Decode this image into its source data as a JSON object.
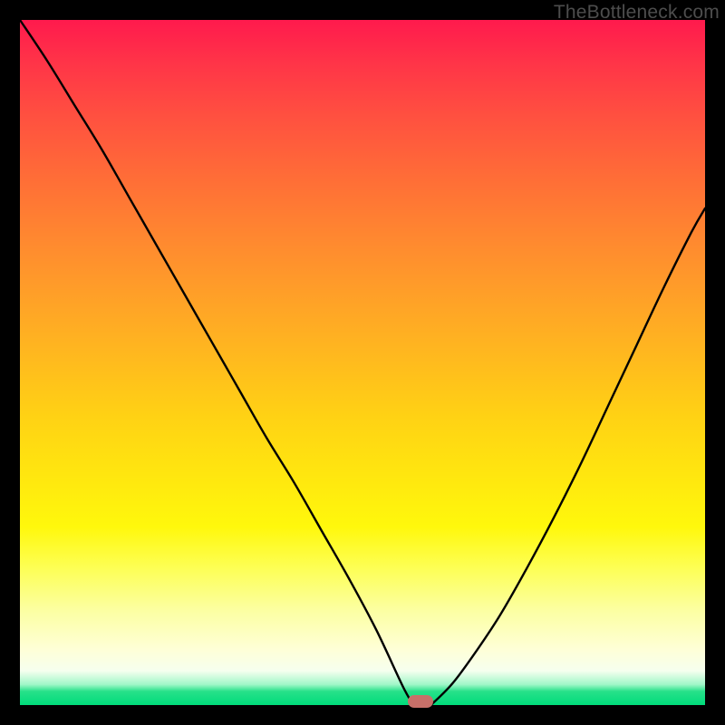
{
  "watermark": {
    "text": "TheBottleneck.com"
  },
  "chart_data": {
    "type": "line",
    "title": "",
    "xlabel": "",
    "ylabel": "",
    "xlim": [
      0,
      100
    ],
    "ylim": [
      0,
      100
    ],
    "series": [
      {
        "name": "left-curve",
        "x": [
          0.0,
          4.0,
          8.0,
          12.0,
          16.0,
          20.0,
          24.0,
          28.0,
          32.0,
          36.0,
          40.0,
          44.0,
          48.0,
          52.0,
          56.0,
          57.5
        ],
        "y": [
          100.0,
          94.0,
          87.5,
          81.0,
          74.0,
          67.0,
          60.0,
          53.0,
          46.0,
          39.0,
          32.5,
          25.5,
          18.5,
          11.0,
          2.5,
          0.0
        ]
      },
      {
        "name": "right-curve",
        "x": [
          60.0,
          63.0,
          66.0,
          70.0,
          74.0,
          78.0,
          82.0,
          86.0,
          90.0,
          94.0,
          98.0,
          100.0
        ],
        "y": [
          0.0,
          3.0,
          7.0,
          13.0,
          20.0,
          27.5,
          35.5,
          44.0,
          52.5,
          61.0,
          69.0,
          72.5
        ]
      }
    ],
    "marker": {
      "name": "optimal-point",
      "x": 58.5,
      "y": 0.5,
      "color": "#c77069"
    },
    "background_gradient": {
      "top": "#ff1a4d",
      "mid": "#ffd214",
      "bottom": "#00db7b"
    },
    "grid": false,
    "legend": false
  }
}
